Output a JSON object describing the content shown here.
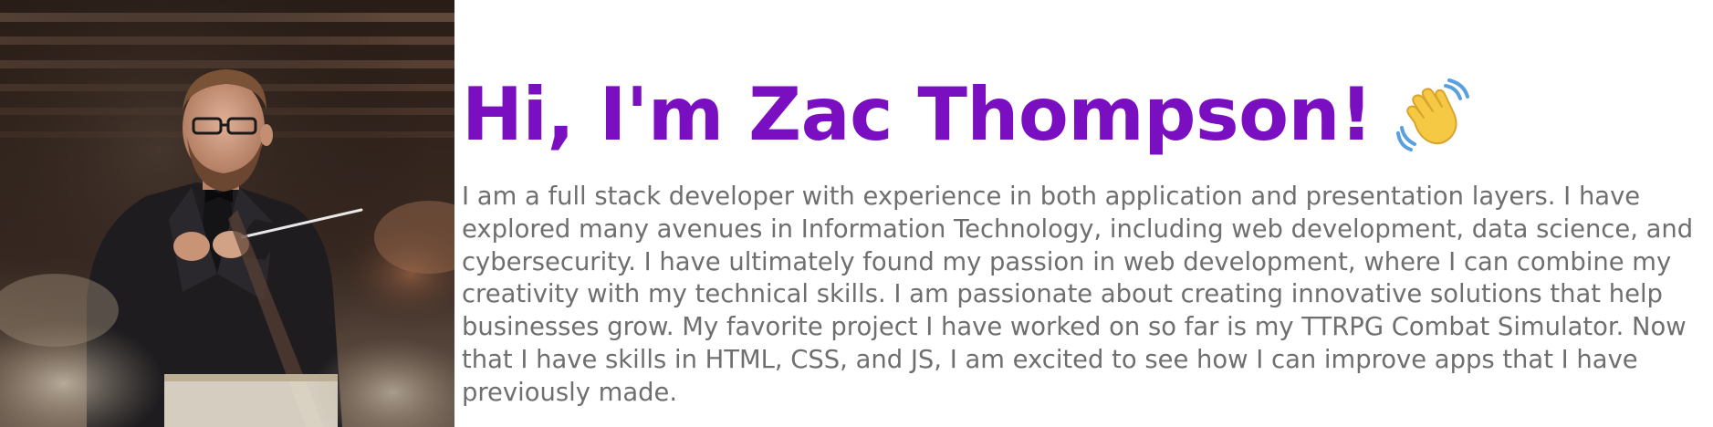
{
  "profile": {
    "photo_alt": "Zac Thompson conducting",
    "greeting": "Hi, I'm Zac Thompson!",
    "wave_emoji": "waving-hand-icon",
    "bio": "I am a full stack developer with experience in both application and presentation layers. I have explored many avenues in Information Technology, including web development, data science, and cybersecurity. I have ultimately found my passion in web development, where I can combine my creativity with my technical skills. I am passionate about creating innovative solutions that help businesses grow. My favorite project I have worked on so far is my TTRPG Combat Simulator. Now that I have skills in HTML, CSS, and JS, I am excited to see how I can improve apps that I have previously made."
  },
  "colors": {
    "heading": "#7a0fc2",
    "body_text": "#6f6f6f",
    "background": "#ffffff"
  }
}
